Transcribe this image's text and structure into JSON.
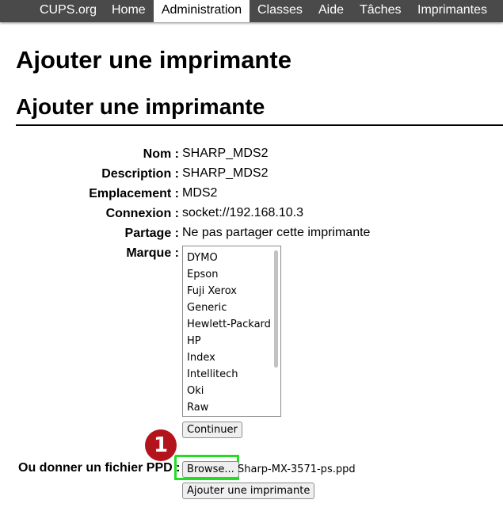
{
  "nav": {
    "items": [
      {
        "label": "CUPS.org"
      },
      {
        "label": "Home"
      },
      {
        "label": "Administration",
        "active": true
      },
      {
        "label": "Classes"
      },
      {
        "label": "Aide"
      },
      {
        "label": "Tâches"
      },
      {
        "label": "Imprimantes"
      }
    ]
  },
  "page": {
    "title": "Ajouter une imprimante",
    "subtitle": "Ajouter une imprimante"
  },
  "form": {
    "name_label": "Nom :",
    "name_value": "SHARP_MDS2",
    "description_label": "Description :",
    "description_value": "SHARP_MDS2",
    "location_label": "Emplacement :",
    "location_value": "MDS2",
    "connection_label": "Connexion :",
    "connection_value": "socket://192.168.10.3",
    "sharing_label": "Partage :",
    "sharing_value": "Ne pas partager cette imprimante",
    "make_label": "Marque :",
    "makes": [
      "DYMO",
      "Epson",
      "Fuji Xerox",
      "Generic",
      "Hewlett-Packard",
      "HP",
      "Index",
      "Intellitech",
      "Oki",
      "Raw"
    ],
    "continue_button": "Continuer",
    "ppd_label": "Ou donner un fichier PPD :",
    "browse_button": "Browse...",
    "ppd_filename": "Sharp-MX-3571-ps.ppd",
    "add_button": "Ajouter une imprimante"
  },
  "annotation": {
    "step_number": "1",
    "badge_color": "#b3141c",
    "highlight_color": "#22dd22"
  }
}
